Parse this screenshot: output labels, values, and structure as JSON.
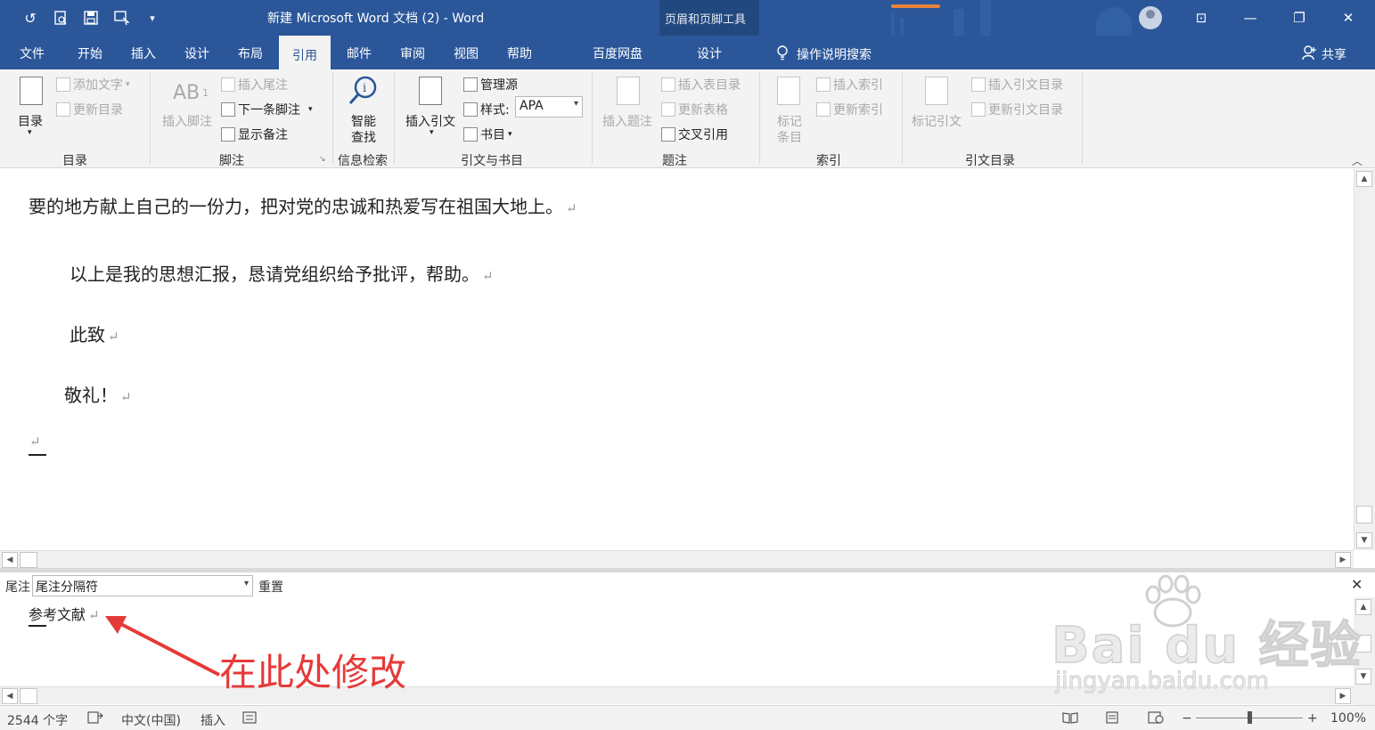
{
  "window": {
    "title": "新建 Microsoft Word 文档 (2)  -  Word",
    "context_tools": "页眉和页脚工具",
    "controls": {
      "ribbon_display": "⊡",
      "minimize": "—",
      "restore": "❐",
      "close": "✕"
    }
  },
  "quick_access": {
    "undo": "↺",
    "print_preview": "🗋",
    "save": "💾",
    "touch_mode": "☞",
    "customize": "▾"
  },
  "tabs": [
    {
      "label": "文件"
    },
    {
      "label": "开始"
    },
    {
      "label": "插入"
    },
    {
      "label": "设计"
    },
    {
      "label": "布局"
    },
    {
      "label": "引用"
    },
    {
      "label": "邮件"
    },
    {
      "label": "审阅"
    },
    {
      "label": "视图"
    },
    {
      "label": "帮助"
    },
    {
      "label": "百度网盘"
    },
    {
      "label": "设计"
    }
  ],
  "tell_me": "操作说明搜索",
  "share": "共享",
  "ribbon": {
    "toc": {
      "toc_button": "目录",
      "add_text": "添加文字",
      "update_toc": "更新目录",
      "label": "目录"
    },
    "footnotes": {
      "insert_footnote": "插入脚注",
      "insert_endnote": "插入尾注",
      "next_footnote": "下一条脚注",
      "show_notes": "显示备注",
      "label": "脚注",
      "ab_icon": "AB",
      "sup": "1"
    },
    "research": {
      "smart_lookup_1": "智能",
      "smart_lookup_2": "查找",
      "label": "信息检索"
    },
    "citations": {
      "insert_citation": "插入引文",
      "manage_sources": "管理源",
      "style_label": "样式:",
      "style_value": "APA",
      "bibliography": "书目",
      "label": "引文与书目"
    },
    "captions": {
      "insert_caption": "插入题注",
      "insert_table_of_figures": "插入表目录",
      "update_table": "更新表格",
      "cross_reference": "交叉引用",
      "label": "题注"
    },
    "index": {
      "mark_entry_1": "标记",
      "mark_entry_2": "条目",
      "insert_index": "插入索引",
      "update_index": "更新索引",
      "label": "索引"
    },
    "authorities": {
      "mark_citation": "标记引文",
      "insert_toa": "插入引文目录",
      "update_toa": "更新引文目录",
      "label": "引文目录"
    }
  },
  "document": {
    "paragraphs": [
      "要的地方献上自己的一份力，把对党的忠诚和热爱写在祖国大地上。",
      "以上是我的思想汇报，恳请党组织给予批评，帮助。",
      "此致",
      "敬礼！"
    ],
    "para_mark": "↵"
  },
  "endnote_pane": {
    "label": "尾注",
    "selected": "尾注分隔符",
    "reset": "重置",
    "close": "✕",
    "text": "参考文献"
  },
  "annotation": {
    "text": "在此处修改",
    "color": "#e53a3a"
  },
  "watermark": {
    "brand": "Bai du 经验",
    "url": "jingyan.baidu.com"
  },
  "statusbar": {
    "word_count": "2544 个字",
    "language": "中文(中国)",
    "mode": "插入",
    "zoom_minus": "−",
    "zoom_plus": "+",
    "zoom": "100%"
  },
  "colors": {
    "accent": "#2b579a",
    "context_accent": "#e8833a"
  }
}
